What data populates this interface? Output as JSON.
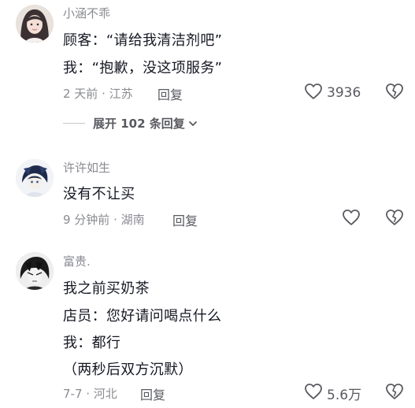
{
  "comments": [
    {
      "username": "小涵不乖",
      "lines": [
        "顾客：“请给我清洁剂吧”",
        "我：“抱歉，没这项服务”"
      ],
      "meta": "2 天前 · 江苏",
      "reply_label": "回复",
      "likes": "3936",
      "expand_label": "展开 102 条回复"
    },
    {
      "username": "许许如生",
      "lines": [
        "没有不让买"
      ],
      "meta": "9 分钟前 · 湖南",
      "reply_label": "回复",
      "likes": ""
    },
    {
      "username": "富贵.",
      "lines": [
        "我之前买奶茶",
        "店员：您好请问喝点什么",
        "我：都行",
        "（两秒后双方沉默）"
      ],
      "meta": "7-7 · 河北",
      "reply_label": "回复",
      "likes": "5.6万"
    }
  ],
  "icons": {
    "like": "heart-outline-icon",
    "dislike": "broken-heart-icon",
    "expand": "chevron-down-icon"
  },
  "colors": {
    "primary_text": "#161823",
    "secondary_text": "#8a8b91",
    "action_text": "#595a60"
  }
}
